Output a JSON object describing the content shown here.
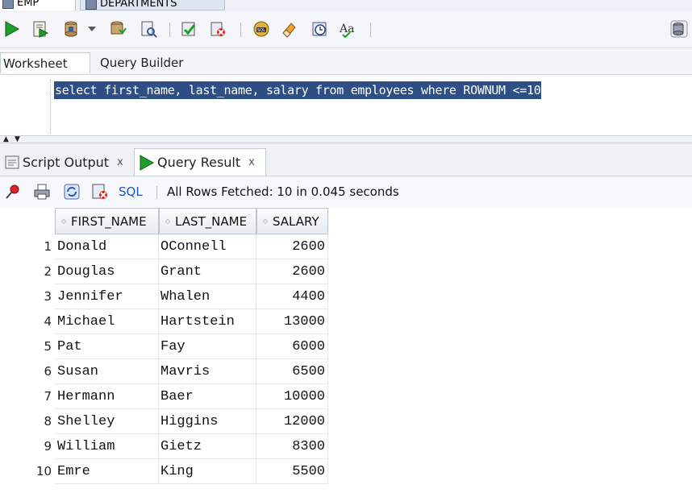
{
  "doc_tabs": [
    {
      "label": "EMP",
      "active": true
    },
    {
      "label": "DEPARTMENTS",
      "active": false
    }
  ],
  "toolbar": {
    "icons": [
      "run-statement-icon",
      "run-script-icon",
      "commit-icon",
      "dropdown-arrow-icon",
      "autotrace-icon",
      "explain-plan-icon",
      "sql-tuning-icon",
      "rollback-icon",
      "sql-history-icon",
      "eraser-icon",
      "clock-icon",
      "format-aa-icon",
      "db-connection-icon"
    ]
  },
  "editor_tabs": [
    {
      "label": "Worksheet",
      "active": true
    },
    {
      "label": "Query Builder",
      "active": false
    }
  ],
  "editor": {
    "sql": "select first_name, last_name, salary from employees where ROWNUM <=10"
  },
  "output_tabs": [
    {
      "label": "Script Output",
      "close": "x",
      "active": false
    },
    {
      "label": "Query Result",
      "close": "x",
      "active": true
    }
  ],
  "result_toolbar": {
    "sql_link": "SQL",
    "status": "All Rows Fetched: 10 in 0.045 seconds"
  },
  "grid": {
    "columns": [
      "FIRST_NAME",
      "LAST_NAME",
      "SALARY"
    ],
    "rows": [
      {
        "n": "1",
        "first_name": "Donald",
        "last_name": "OConnell",
        "salary": "2600"
      },
      {
        "n": "2",
        "first_name": "Douglas",
        "last_name": "Grant",
        "salary": "2600"
      },
      {
        "n": "3",
        "first_name": "Jennifer",
        "last_name": "Whalen",
        "salary": "4400"
      },
      {
        "n": "4",
        "first_name": "Michael",
        "last_name": "Hartstein",
        "salary": "13000"
      },
      {
        "n": "5",
        "first_name": "Pat",
        "last_name": "Fay",
        "salary": "6000"
      },
      {
        "n": "6",
        "first_name": "Susan",
        "last_name": "Mavris",
        "salary": "6500"
      },
      {
        "n": "7",
        "first_name": "Hermann",
        "last_name": "Baer",
        "salary": "10000"
      },
      {
        "n": "8",
        "first_name": "Shelley",
        "last_name": "Higgins",
        "salary": "12000"
      },
      {
        "n": "9",
        "first_name": "William",
        "last_name": "Gietz",
        "salary": "8300"
      },
      {
        "n": "10",
        "first_name": "Emre",
        "last_name": "King",
        "salary": "5500"
      }
    ]
  },
  "colors": {
    "selection": "#2e4f86",
    "run_green": "#1e9e2a",
    "link_blue": "#1a56b4"
  }
}
